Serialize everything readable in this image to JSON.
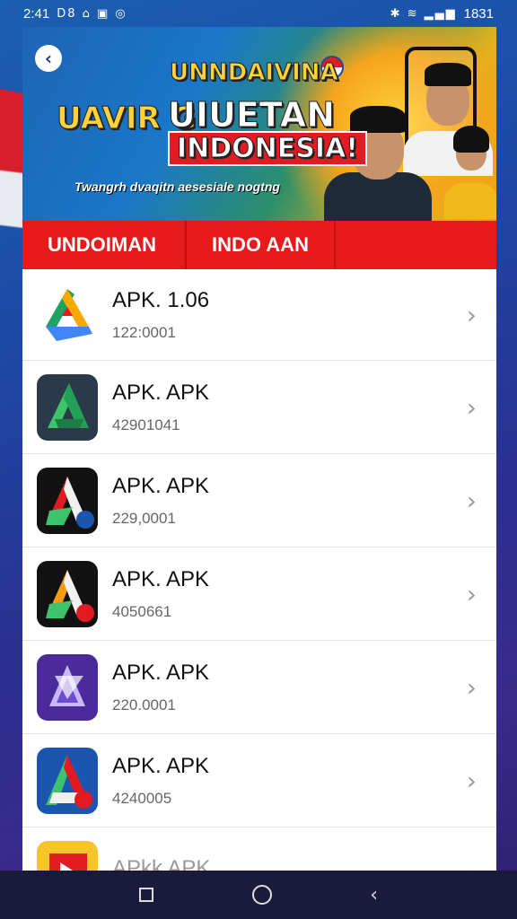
{
  "status_bar": {
    "time": "2:41",
    "left_icons": "D8 ⌂ ▣ ◎",
    "right_icons": "✱ ≋ ▂▄▆",
    "battery": "1831"
  },
  "banner": {
    "headline_line1": "UNNDAIVINA",
    "headline_line2a": "UAVIR G",
    "headline_line2b": "UIUETAN",
    "headline_line3": "INDONESIA!",
    "tagline": "Twangrh dvaqitn aesesiale nogtng"
  },
  "tabs": [
    {
      "label": "UNDOIMAN"
    },
    {
      "label": "INDO AAN"
    },
    {
      "label": ""
    }
  ],
  "apps": [
    {
      "title": "APK. 1.06",
      "subtitle": "122:0001",
      "icon": "google-drive-style-icon",
      "colors": [
        "#1ea362",
        "#4285f4",
        "#f7a900"
      ]
    },
    {
      "title": "APK. APK",
      "subtitle": "42901041",
      "icon": "green-a-on-dark-icon",
      "colors": [
        "#2a3a4a",
        "#3cc36b"
      ]
    },
    {
      "title": "APK. APK",
      "subtitle": "229,0001",
      "icon": "red-a-on-black-icon",
      "colors": [
        "#111111",
        "#e21b23"
      ]
    },
    {
      "title": "APK. APK",
      "subtitle": "4050661",
      "icon": "orange-a-on-black-icon",
      "colors": [
        "#111111",
        "#f39c12"
      ]
    },
    {
      "title": "APK. APK",
      "subtitle": "220.0001",
      "icon": "purple-triangle-icon",
      "colors": [
        "#4b2a9a",
        "#c9b8ff"
      ]
    },
    {
      "title": "APK. APK",
      "subtitle": "4240005",
      "icon": "blue-red-a-icon",
      "colors": [
        "#1a56b0",
        "#e21b23"
      ]
    },
    {
      "title": "APkk APK",
      "subtitle": "",
      "icon": "yellow-red-play-icon",
      "colors": [
        "#f7c52b",
        "#e21b23"
      ]
    }
  ],
  "nav": {
    "recents": "recents-icon",
    "home": "home-icon",
    "back": "back-icon"
  }
}
